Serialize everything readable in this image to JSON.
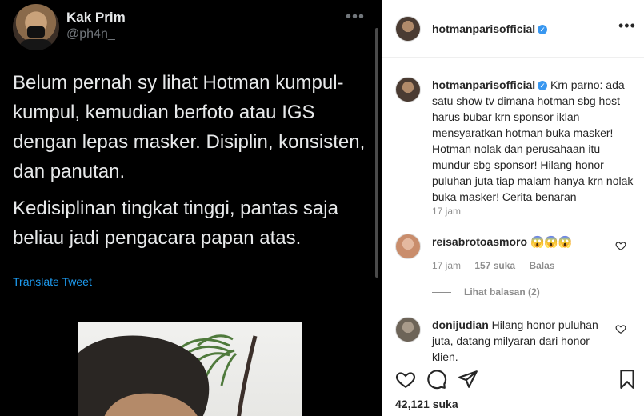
{
  "tweet": {
    "name": "Kak Prim",
    "handle": "@ph4n_",
    "paragraphs": [
      "Belum pernah sy lihat Hotman kumpul-kumpul, kemudian berfoto atau IGS dengan lepas masker. Disiplin, konsisten, dan panutan.",
      "Kedisiplinan tingkat tinggi, pantas saja beliau jadi pengacara papan atas."
    ],
    "translate_label": "Translate Tweet",
    "more_label": "•••"
  },
  "post": {
    "header_username": "hotmanparisofficial",
    "more_label": "•••",
    "caption": {
      "username": "hotmanparisofficial",
      "text": "Krn parno: ada satu show tv dimana hotman sbg host harus bubar krn sponsor iklan mensyaratkan hotman buka masker! Hotman nolak dan perusahaan itu mundur sbg sponsor! Hilang honor puluhan juta tiap malam hanya krn nolak buka masker! Cerita benaran",
      "time": "17 jam"
    },
    "comments": [
      {
        "username": "reisabrotoasmoro",
        "text": "😱😱😱",
        "time": "17 jam",
        "likes": "157 suka",
        "reply_label": "Balas",
        "view_replies": "Lihat balasan (2)"
      },
      {
        "username": "donijudian",
        "text": "Hilang honor puluhan juta, datang milyaran dari honor klien."
      }
    ],
    "likes_count": "42,121 suka"
  },
  "colors": {
    "tweet_bg": "#000000",
    "tweet_link": "#1d9bf0",
    "verified": "#3897f0"
  }
}
